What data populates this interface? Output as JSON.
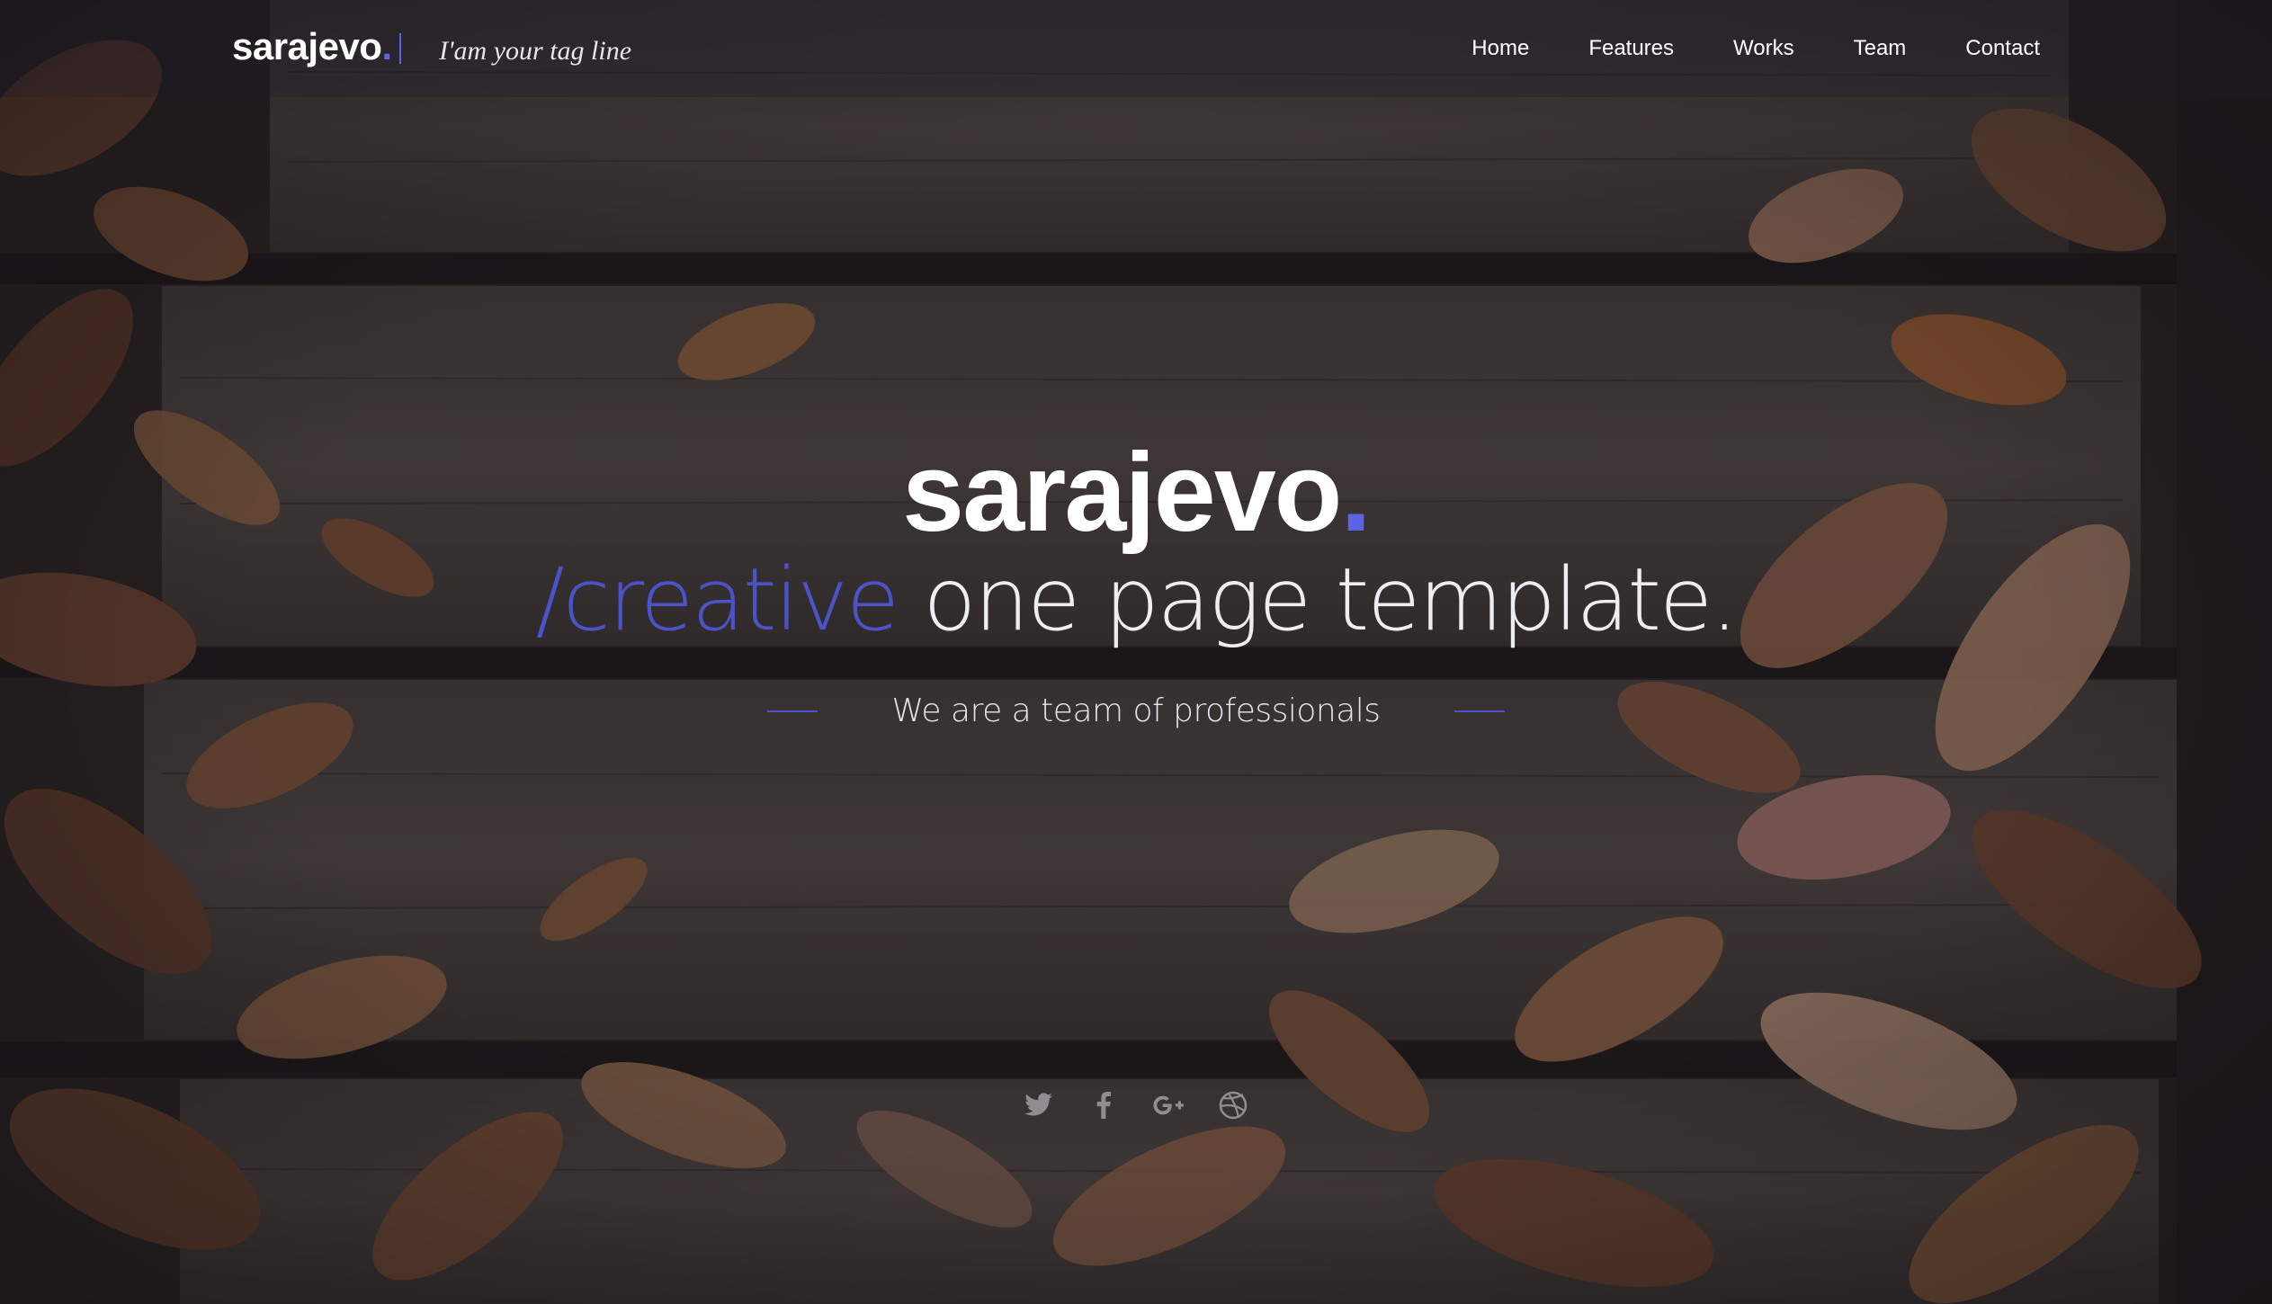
{
  "brand": {
    "name": "sarajevo",
    "dot": ".",
    "tagline": "I'am your tag line"
  },
  "nav": {
    "items": [
      {
        "label": "Home"
      },
      {
        "label": "Features"
      },
      {
        "label": "Works"
      },
      {
        "label": "Team"
      },
      {
        "label": "Contact"
      }
    ]
  },
  "hero": {
    "title": "sarajevo",
    "title_dot": ".",
    "subtitle_accent": "/creative",
    "subtitle_rest": " one page template.",
    "tagline": "We are a team of professionals"
  },
  "social": {
    "icons": [
      "twitter-icon",
      "facebook-icon",
      "google-plus-icon",
      "dribbble-icon"
    ]
  },
  "colors": {
    "accent": "#5b63e6",
    "text": "#ffffff"
  }
}
